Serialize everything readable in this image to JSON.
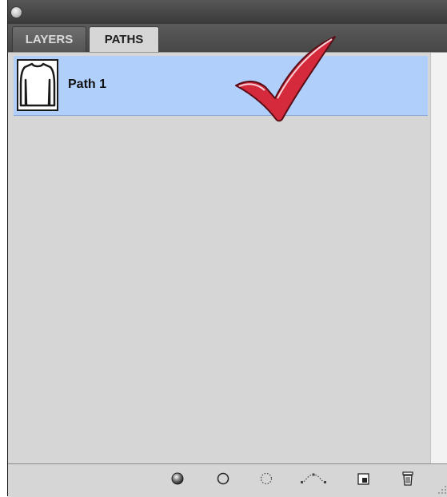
{
  "panel": {
    "tabs": [
      {
        "label": "LAYERS",
        "active": false
      },
      {
        "label": "PATHS",
        "active": true
      }
    ],
    "colors": {
      "selected_row": "#b0d0fb",
      "panel_bg": "#d6d6d6",
      "checkmark": "#d42a3c"
    }
  },
  "paths": [
    {
      "name": "Path 1",
      "selected": true,
      "thumbnail": "long-sleeve-shirt-icon"
    }
  ],
  "annotation": {
    "icon": "checkmark-icon"
  },
  "footer": {
    "buttons": [
      {
        "name": "fill-path-button",
        "icon": "filled-circle-icon"
      },
      {
        "name": "stroke-path-button",
        "icon": "outline-circle-icon"
      },
      {
        "name": "load-as-selection-button",
        "icon": "dotted-circle-icon"
      },
      {
        "name": "make-work-path-button",
        "icon": "work-path-icon"
      },
      {
        "name": "new-path-button",
        "icon": "new-page-icon"
      },
      {
        "name": "delete-path-button",
        "icon": "trash-icon"
      }
    ]
  }
}
